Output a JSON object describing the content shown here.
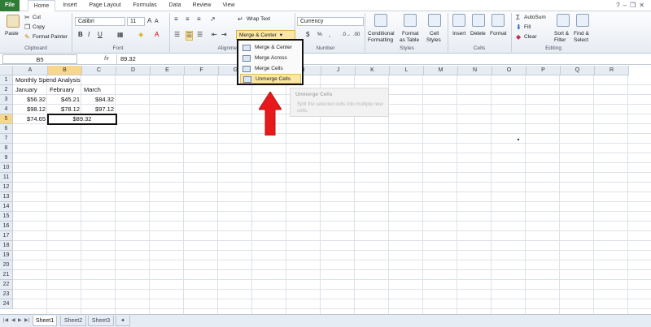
{
  "ribbon_tabs": [
    "File",
    "Home",
    "Insert",
    "Page Layout",
    "Formulas",
    "Data",
    "Review",
    "View"
  ],
  "clipboard": {
    "paste": "Paste",
    "cut": "Cut",
    "copy": "Copy",
    "format_painter": "Format Painter",
    "label": "Clipboard"
  },
  "font": {
    "name": "Calibri",
    "size": "11",
    "label": "Font"
  },
  "alignment": {
    "wrap_text": "Wrap Text",
    "merge_center": "Merge & Center",
    "label": "Alignment"
  },
  "number": {
    "format": "Currency",
    "percent": "%",
    "label": "Number"
  },
  "styles": {
    "conditional": "Conditional",
    "conditional2": "Formatting",
    "format_as": "Format",
    "format_as2": "as Table",
    "cell_styles": "Cell",
    "cell_styles2": "Styles",
    "label": "Styles"
  },
  "cells": {
    "insert": "Insert",
    "delete": "Delete",
    "format": "Format",
    "label": "Cells"
  },
  "editing": {
    "autosum": "AutoSum",
    "fill": "Fill",
    "clear": "Clear",
    "sort": "Sort &",
    "sort2": "Filter",
    "find": "Find &",
    "find2": "Select",
    "label": "Editing"
  },
  "merge_menu": {
    "items": [
      "Merge & Center",
      "Merge Across",
      "Merge Cells",
      "Unmerge Cells"
    ],
    "highlighted": "Unmerge Cells"
  },
  "tooltip": {
    "title": "Unmerge Cells",
    "body": "Split the selected cells into multiple new cells."
  },
  "formula_bar": {
    "name_box": "B5",
    "fx": "fx",
    "value": "89.32"
  },
  "columns": [
    "A",
    "B",
    "C",
    "D",
    "E",
    "F",
    "G",
    "H",
    "I",
    "J",
    "K",
    "L",
    "M",
    "N",
    "O",
    "P",
    "Q",
    "R"
  ],
  "rows": [
    "1",
    "2",
    "3",
    "4",
    "5",
    "6",
    "7",
    "8",
    "9",
    "10",
    "11",
    "12",
    "13",
    "14",
    "15",
    "16",
    "17",
    "18",
    "19",
    "20",
    "21",
    "22",
    "23",
    "24"
  ],
  "sheet": {
    "title": "Monthly Spend Analysis",
    "headers": [
      "January",
      "February",
      "March"
    ],
    "row3": [
      "$56.32",
      "$45.21",
      "$84.32"
    ],
    "row4": [
      "$98.12",
      "$78.12",
      "$97.12"
    ],
    "row5": [
      "$74.65",
      "$89.32"
    ]
  },
  "sheet_tabs": [
    "Sheet1",
    "Sheet2",
    "Sheet3"
  ],
  "colors": {
    "accent": "#2f7c36",
    "highlight": "#fbe7a3",
    "arrow": "#e8191b"
  }
}
